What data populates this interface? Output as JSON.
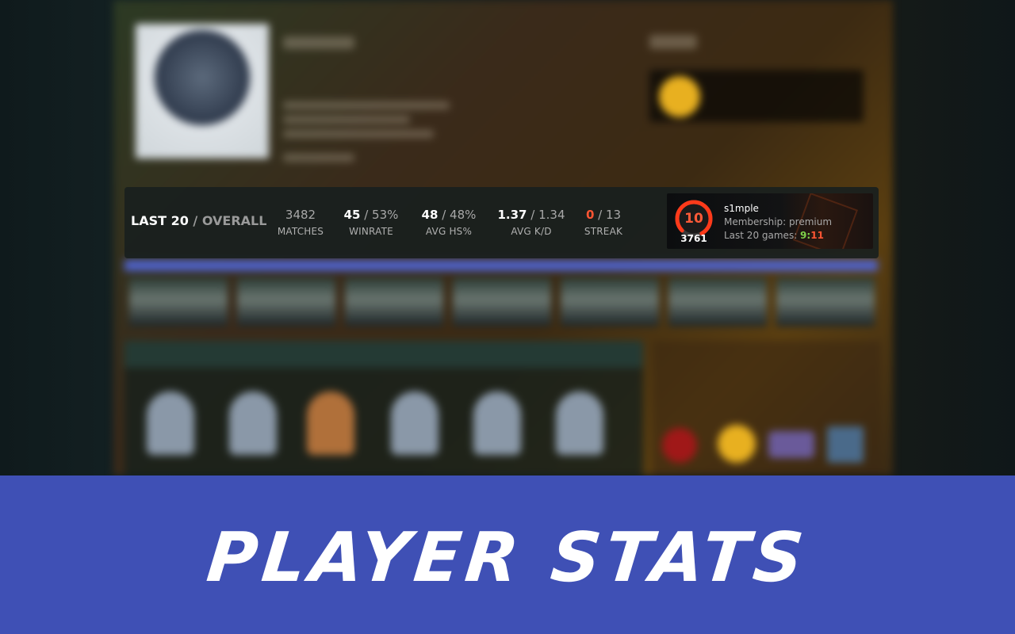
{
  "stats_bar": {
    "period_label": "LAST 20",
    "separator": " / ",
    "overall_label": "OVERALL",
    "matches": {
      "value": "3482",
      "label": "MATCHES"
    },
    "winrate": {
      "value": "45",
      "rest": " / 53%",
      "label": "WINRATE"
    },
    "avg_hs": {
      "value": "48",
      "rest": " / 48%",
      "label": "AVG HS%"
    },
    "avg_kd": {
      "value": "1.37",
      "rest": " / 1.34",
      "label": "AVG K/D"
    },
    "streak": {
      "value": "0",
      "rest": " / 13",
      "label": "STREAK"
    }
  },
  "player_card": {
    "level": "10",
    "elo": "3761",
    "name": "s1mple",
    "membership": "Membership: premium",
    "last_games_label": "Last 20 games: ",
    "wins": "9",
    "colon": ":",
    "losses": "11",
    "level_color": "#ff5a38",
    "win_color": "#7fd24a",
    "loss_color": "#ff5533"
  },
  "banner": {
    "title": "PLAYER STATS",
    "background": "#3f50b5"
  }
}
